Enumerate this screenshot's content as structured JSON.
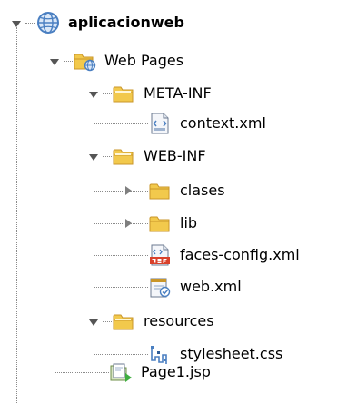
{
  "tree": {
    "root": {
      "label": "aplicacionweb",
      "children": {
        "web_pages": {
          "label": "Web Pages",
          "children": {
            "meta_inf": {
              "label": "META-INF",
              "children": {
                "context_xml": {
                  "label": "context.xml"
                }
              }
            },
            "web_inf": {
              "label": "WEB-INF",
              "children": {
                "clases": {
                  "label": "clases"
                },
                "lib": {
                  "label": "lib"
                },
                "faces_config": {
                  "label": "faces-config.xml"
                },
                "web_xml": {
                  "label": "web.xml"
                }
              }
            },
            "resources": {
              "label": "resources",
              "children": {
                "stylesheet": {
                  "label": "stylesheet.css"
                }
              }
            },
            "page1": {
              "label": "Page1.jsp"
            }
          }
        }
      }
    }
  },
  "colors": {
    "folder": "#f2c94c",
    "folder_dark": "#c9962a",
    "globe": "#4a7fc1",
    "guide_line": "#8a8a8a"
  }
}
